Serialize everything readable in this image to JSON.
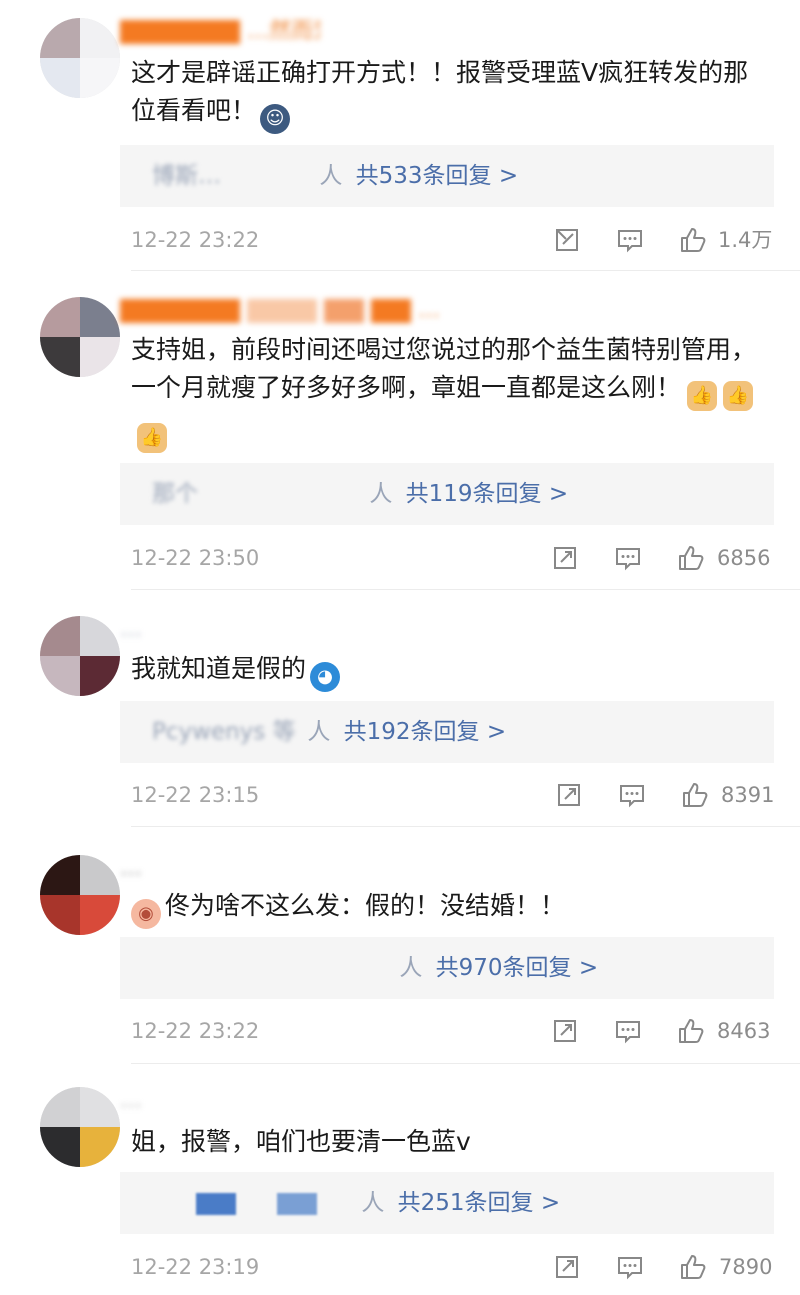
{
  "comments": [
    {
      "username": "…然而爱之",
      "text": "这才是辟谣正确打开方式！！报警受理蓝V疯狂转发的那位看看吧！",
      "emoji": "face-icon",
      "replies_people": "人",
      "replies_count": "共533条回复 >",
      "reply_names": "博斯…",
      "time": "12-22 23:22",
      "likes": "1.4万"
    },
    {
      "username": "…",
      "text": "支持姐，前段时间还喝过您说过的那个益生菌特别管用，一个月就瘦了好多好多啊，章姐一直都是这么刚！",
      "emoji": "thumbs-up-icon",
      "replies_people": "人",
      "replies_count": "共119条回复 >",
      "reply_names": "那个",
      "time": "12-22 23:50",
      "likes": "6856"
    },
    {
      "username": "…",
      "text": "我就知道是假的",
      "emoji": "doraemon-icon",
      "replies_people": "人",
      "replies_count": "共192条回复 >",
      "reply_names": "Pcywenys 等",
      "time": "12-22 23:15",
      "likes": "8391"
    },
    {
      "username": "…",
      "text": "佟为啥不这么发：假的！没结婚！！",
      "emoji": "pig-face-icon",
      "replies_people": "人",
      "replies_count": "共970条回复 >",
      "reply_names": "",
      "time": "12-22 23:22",
      "likes": "8463"
    },
    {
      "username": "…",
      "text": "姐，报警，咱们也要清一色蓝v",
      "emoji": "",
      "replies_people": "人",
      "replies_count": "共251条回复 >",
      "reply_names": "",
      "time": "12-22 23:19",
      "likes": "7890"
    }
  ]
}
